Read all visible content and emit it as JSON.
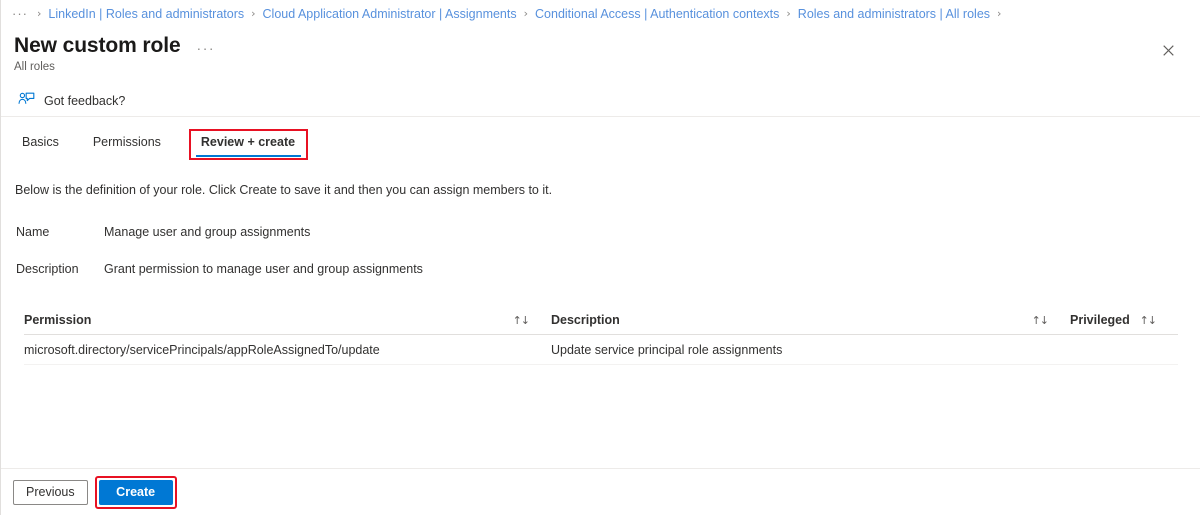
{
  "breadcrumb": {
    "overflow_label": "···",
    "separator": "›",
    "items": [
      {
        "label": "LinkedIn | Roles and administrators"
      },
      {
        "label": "Cloud Application Administrator | Assignments"
      },
      {
        "label": "Conditional Access | Authentication contexts"
      },
      {
        "label": "Roles and administrators | All roles"
      }
    ]
  },
  "header": {
    "title": "New custom role",
    "more_label": "···",
    "subtitle": "All roles",
    "close_label": "✕"
  },
  "feedback": {
    "label": "Got feedback?",
    "icon": "feedback-person-icon"
  },
  "tabs": [
    {
      "label": "Basics",
      "active": false
    },
    {
      "label": "Permissions",
      "active": false
    },
    {
      "label": "Review + create",
      "active": true,
      "annotated": true
    }
  ],
  "blade_description": "Below is the definition of your role. Click Create to save it and then you can assign members to it.",
  "summary": [
    {
      "label": "Name",
      "value": "Manage user and group assignments"
    },
    {
      "label": "Description",
      "value": "Grant permission to manage user and group assignments"
    }
  ],
  "table": {
    "sort_icon": "↑↓",
    "columns": [
      {
        "key": "permission",
        "label": "Permission",
        "sortable": true
      },
      {
        "key": "description",
        "label": "Description",
        "sortable": true
      },
      {
        "key": "privileged",
        "label": "Privileged",
        "sortable": true
      }
    ],
    "rows": [
      {
        "permission": "microsoft.directory/servicePrincipals/appRoleAssignedTo/update",
        "description": "Update service principal role assignments",
        "privileged": ""
      }
    ]
  },
  "footer": {
    "previous_label": "Previous",
    "create_label": "Create"
  },
  "colors": {
    "accent": "#0078d4",
    "link": "#5891dd",
    "annotation": "#e81123",
    "text": "#323130",
    "muted": "#605e5c"
  }
}
